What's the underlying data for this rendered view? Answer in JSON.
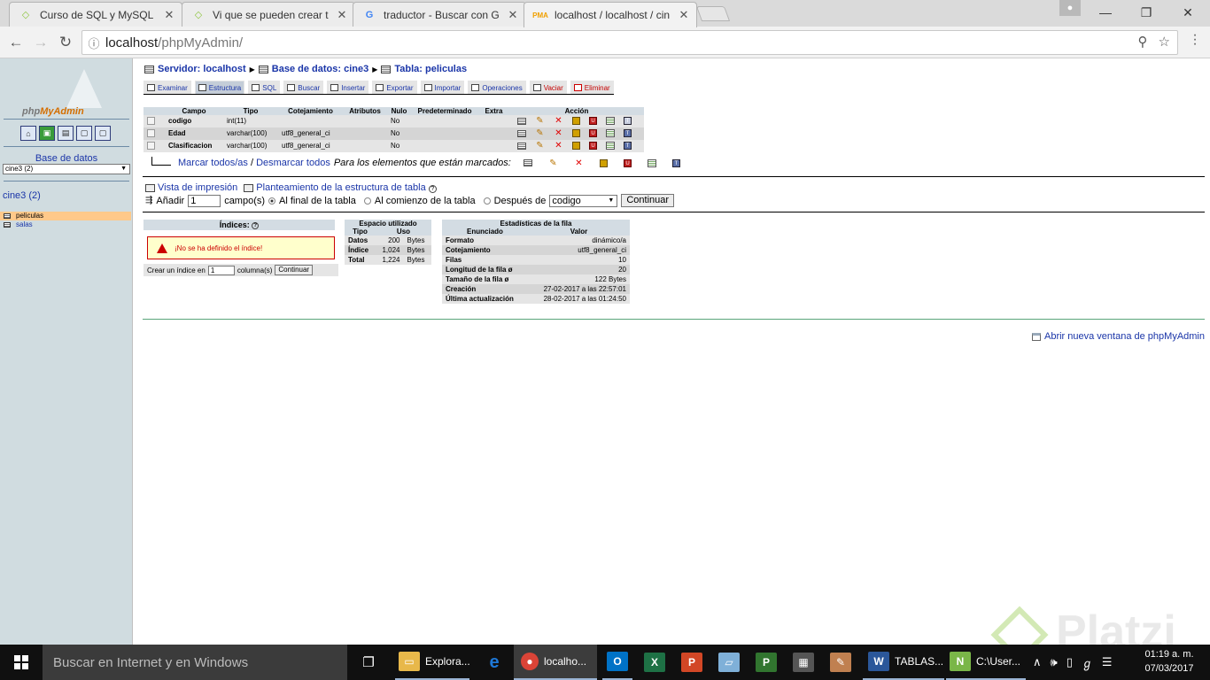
{
  "browser": {
    "tabs": [
      {
        "title": "Curso de SQL y MySQL",
        "icon": "platzi-favicon",
        "color": "#8dc63f"
      },
      {
        "title": "Vi que se pueden crear t",
        "icon": "platzi-favicon",
        "color": "#8dc63f"
      },
      {
        "title": "traductor - Buscar con G",
        "icon": "google-favicon",
        "color": "#4285f4"
      },
      {
        "title": "localhost / localhost / cin",
        "icon": "phpmyadmin-favicon",
        "color": "#f0a000"
      }
    ],
    "url_host": "localhost",
    "url_path": "/phpMyAdmin/"
  },
  "left": {
    "logo_text_1": "php",
    "logo_text_2": "MyAdmin",
    "db_label": "Base de datos",
    "db_select": "cine3 (2)",
    "db_link": "cine3 (2)",
    "tables": [
      "peliculas",
      "salas"
    ]
  },
  "breadcrumb": {
    "server": "Servidor: localhost",
    "database": "Base de datos: cine3",
    "table": "Tabla: peliculas"
  },
  "tabs": [
    {
      "label": "Examinar"
    },
    {
      "label": "Estructura",
      "active": true
    },
    {
      "label": "SQL"
    },
    {
      "label": "Buscar"
    },
    {
      "label": "Insertar"
    },
    {
      "label": "Exportar"
    },
    {
      "label": "Importar"
    },
    {
      "label": "Operaciones"
    },
    {
      "label": "Vaciar",
      "danger": true
    },
    {
      "label": "Eliminar",
      "danger": true
    }
  ],
  "structure": {
    "headers": [
      "Campo",
      "Tipo",
      "Cotejamiento",
      "Atributos",
      "Nulo",
      "Predeterminado",
      "Extra",
      "Acción"
    ],
    "rows": [
      {
        "campo": "codigo",
        "tipo": "int(11)",
        "cotejamiento": "",
        "atributos": "",
        "nulo": "No",
        "predeterminado": "",
        "extra": ""
      },
      {
        "campo": "Edad",
        "tipo": "varchar(100)",
        "cotejamiento": "utf8_general_ci",
        "atributos": "",
        "nulo": "No",
        "predeterminado": "",
        "extra": ""
      },
      {
        "campo": "Clasificacion",
        "tipo": "varchar(100)",
        "cotejamiento": "utf8_general_ci",
        "atributos": "",
        "nulo": "No",
        "predeterminado": "",
        "extra": ""
      }
    ],
    "check_all": "Marcar todos/as",
    "separator": "/",
    "uncheck_all": "Desmarcar todos",
    "with_selected": "Para los elementos que están marcados:"
  },
  "print_view": "Vista de impresión",
  "relation_view": "Planteamiento de la estructura de tabla",
  "add_field": {
    "label": "Añadir",
    "value": "1",
    "fields_label": "campo(s)",
    "opt_end": "Al final de la tabla",
    "opt_begin": "Al comienzo de la tabla",
    "opt_after": "Después de",
    "after_select": "codigo",
    "button": "Continuar"
  },
  "indexes": {
    "title": "Índices:",
    "warning": "¡No se ha definido el índice!",
    "create_label": "Crear un índice en",
    "create_value": "1",
    "columns_label": "columna(s)",
    "button": "Continuar"
  },
  "space": {
    "title": "Espacio utilizado",
    "headers": [
      "Tipo",
      "Uso"
    ],
    "rows": [
      {
        "tipo": "Datos",
        "valor": "200",
        "unidad": "Bytes"
      },
      {
        "tipo": "Índice",
        "valor": "1,024",
        "unidad": "Bytes"
      },
      {
        "tipo": "Total",
        "valor": "1,224",
        "unidad": "Bytes"
      }
    ]
  },
  "stats": {
    "title": "Estadísticas de la fila",
    "headers": [
      "Enunciado",
      "Valor"
    ],
    "rows": [
      {
        "k": "Formato",
        "v": "dinámico/a"
      },
      {
        "k": "Cotejamiento",
        "v": "utf8_general_ci"
      },
      {
        "k": "Filas",
        "v": "10"
      },
      {
        "k": "Longitud de la fila ø",
        "v": "20"
      },
      {
        "k": "Tamaño de la fila ø",
        "v": "122 Bytes"
      },
      {
        "k": "Creación",
        "v": "27-02-2017 a las 22:57:01"
      },
      {
        "k": "Última actualización",
        "v": "28-02-2017 a las 01:24:50"
      }
    ]
  },
  "new_window": "Abrir nueva ventana de phpMyAdmin",
  "watermark": "Platzi",
  "taskbar": {
    "search_placeholder": "Buscar en Internet y en Windows",
    "items": [
      {
        "label": "Explora...",
        "icon": "file-explorer-icon",
        "color": "#e8b84a"
      },
      {
        "label": "",
        "icon": "edge-icon",
        "color": "#1e78d7"
      },
      {
        "label": "localho...",
        "icon": "chrome-icon",
        "color": "#db4437"
      },
      {
        "label": "",
        "icon": "outlook-icon",
        "color": "#0072c6"
      },
      {
        "label": "",
        "icon": "excel-icon",
        "color": "#1e7145"
      },
      {
        "label": "",
        "icon": "powerpoint-icon",
        "color": "#d24726"
      },
      {
        "label": "",
        "icon": "notes-icon",
        "color": "#7fb0d8"
      },
      {
        "label": "",
        "icon": "project-icon",
        "color": "#31752f"
      },
      {
        "label": "",
        "icon": "calculator-icon",
        "color": "#555555"
      },
      {
        "label": "",
        "icon": "paint-icon",
        "color": "#c08050"
      },
      {
        "label": "TABLAS...",
        "icon": "word-icon",
        "color": "#2b579a"
      },
      {
        "label": "C:\\User...",
        "icon": "notepadpp-icon",
        "color": "#7ab648"
      }
    ],
    "time": "01:19 a. m.",
    "date": "07/03/2017"
  }
}
